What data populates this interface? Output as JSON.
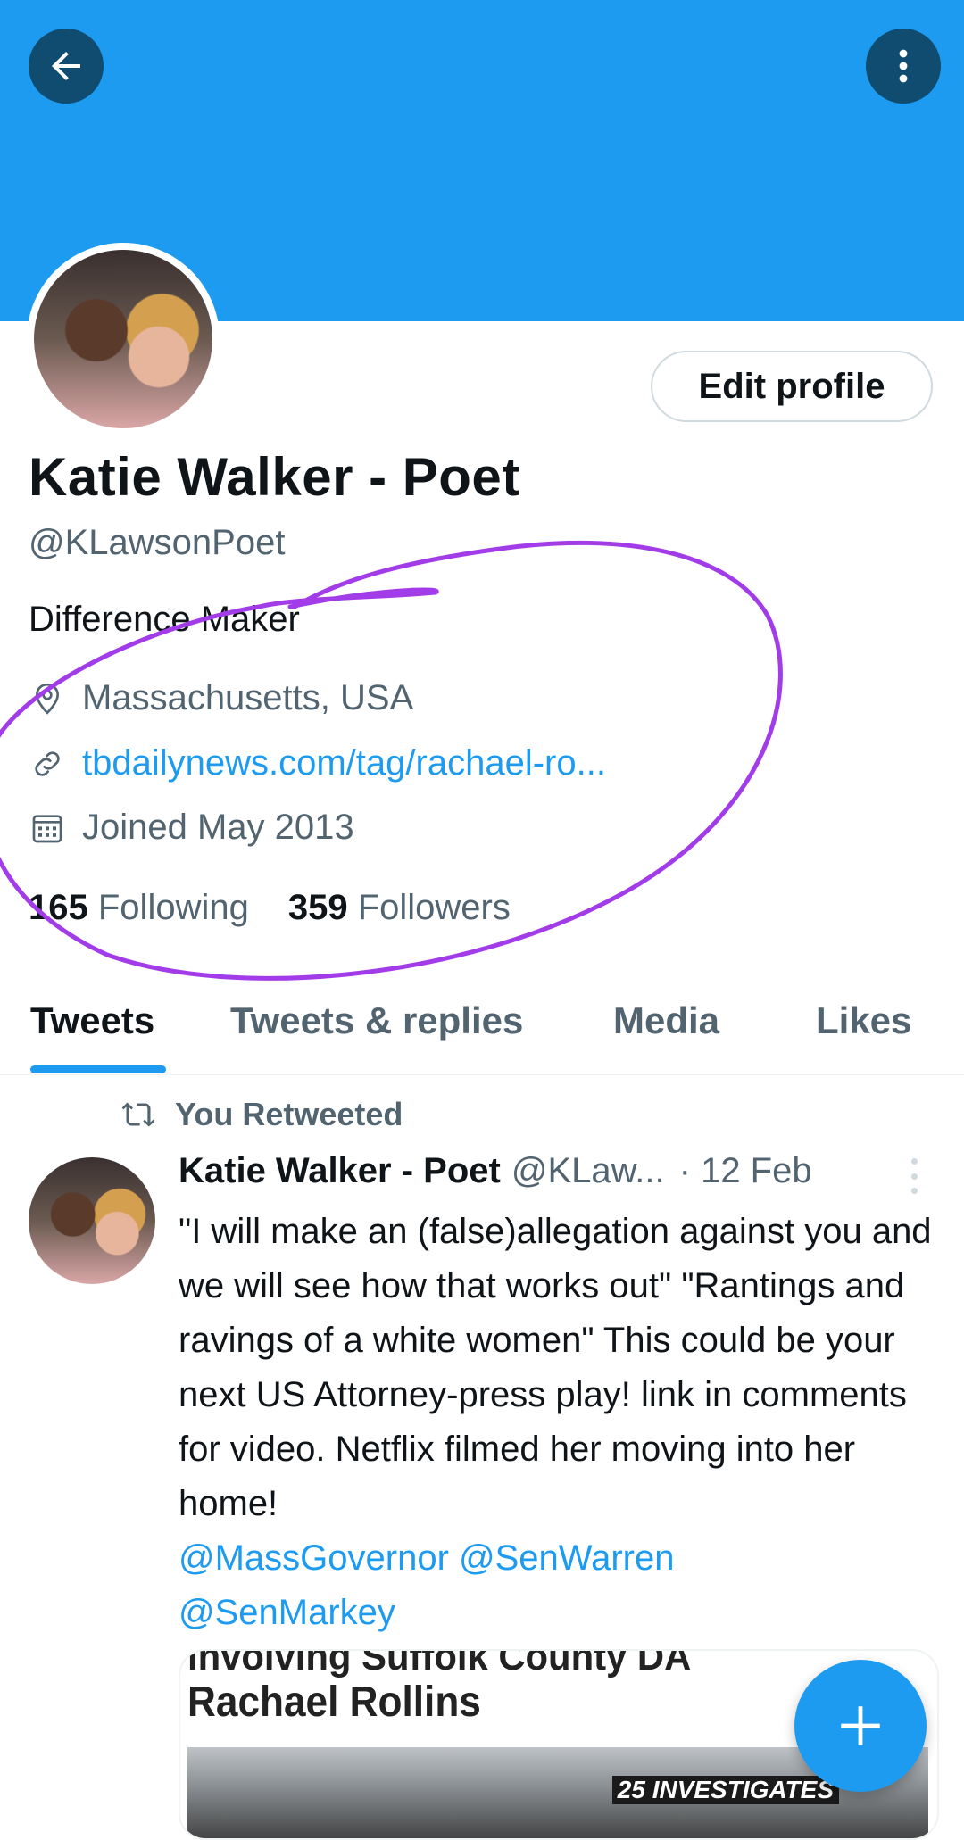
{
  "header": {
    "back_icon": "arrow-left-icon",
    "more_icon": "more-vertical-icon",
    "banner_color": "#1d9bf0"
  },
  "profile": {
    "name": "Katie Walker - Poet",
    "handle": "@KLawsonPoet",
    "edit_button_label": "Edit profile",
    "bio": "Difference Maker",
    "location": "Massachusetts, USA",
    "website": "tbdailynews.com/tag/rachael-ro...",
    "joined": "Joined May 2013",
    "following_count": "165",
    "following_label": "Following",
    "followers_count": "359",
    "followers_label": "Followers"
  },
  "tabs": [
    {
      "label": "Tweets",
      "active": true
    },
    {
      "label": "Tweets & replies",
      "active": false
    },
    {
      "label": "Media",
      "active": false
    },
    {
      "label": "Likes",
      "active": false
    }
  ],
  "tweet": {
    "retweet_label": "You Retweeted",
    "author_name": "Katie Walker - Poet",
    "author_handle": "@KLaw...",
    "date": "· 12 Feb",
    "text": "\"I will make an (false)allegation against you and we will see how that works out\" \"Rantings and ravings of a white women\" This could be your next US Attorney-press play!  link in comments for video. Netflix filmed her moving into her home!",
    "mentions_line1": "@MassGovernor @SenWarren",
    "mentions_line2": "@SenMarkey",
    "media": {
      "top_line": "involving Suffolk County DA",
      "title": "Rachael Rollins",
      "badge": "25 INVESTIGATES"
    }
  },
  "fab": {
    "icon": "plus-icon"
  },
  "colors": {
    "accent": "#1d9bf0",
    "annotation": "#a23be8",
    "secondary_text": "#536471"
  }
}
